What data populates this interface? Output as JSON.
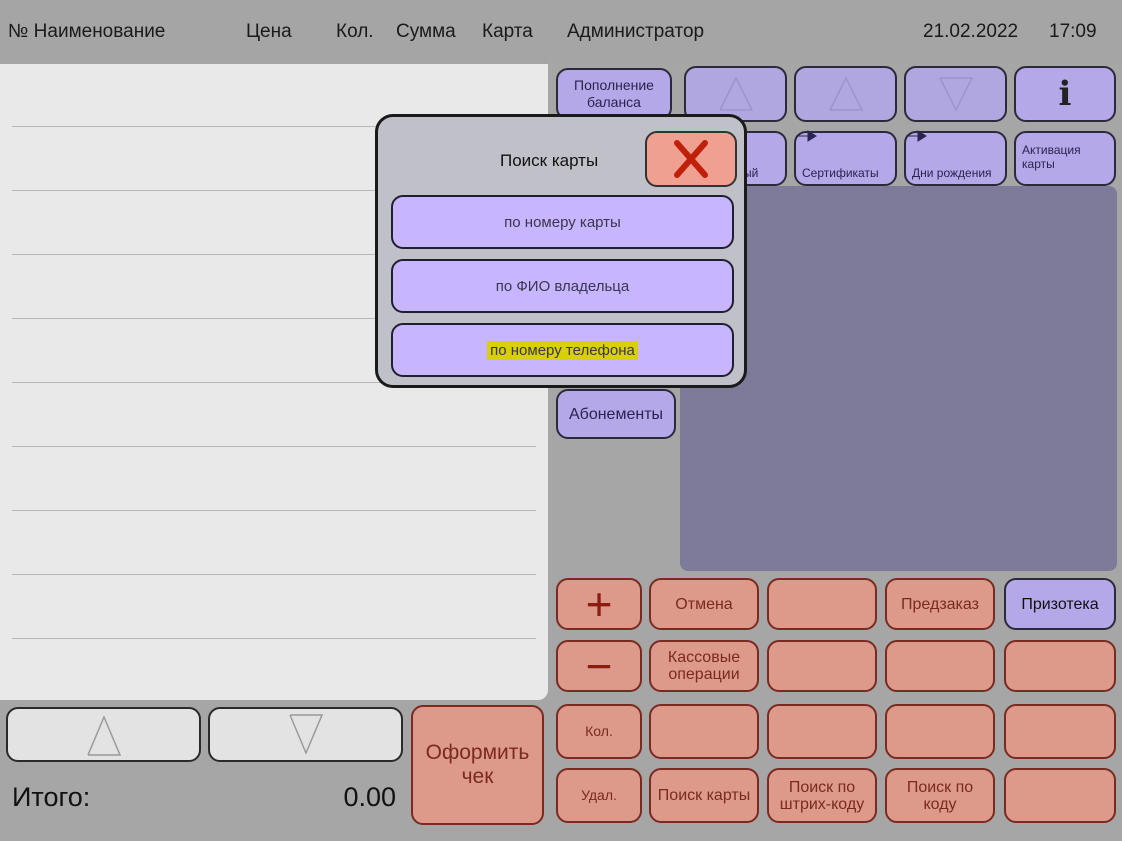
{
  "receipt": {
    "headers": {
      "num_name": "№ Наименование",
      "price": "Цена",
      "qty": "Кол.",
      "sum": "Сумма",
      "card": "Карта"
    },
    "total_label": "Итого:",
    "total_value": "0.00",
    "checkout_label": "Оформить чек"
  },
  "topbar": {
    "user": "Администратор",
    "date": "21.02.2022",
    "time": "17:09"
  },
  "function_buttons": {
    "topup": "Пополнение баланса",
    "info": "i",
    "fragment": "ый",
    "certificates": "Сертификаты",
    "birthdays": "Дни рождения",
    "card_activation": "Активация карты",
    "subscriptions": "Абонементы"
  },
  "keypad": {
    "plus": "+",
    "minus": "−",
    "cancel": "Отмена",
    "preorder": "Предзаказ",
    "prize": "Призотека",
    "cash_ops": "Кассовые операции",
    "qty": "Кол.",
    "delete": "Удал.",
    "card_search": "Поиск карты",
    "barcode_search": "Поиск по штрих-коду",
    "code_search": "Поиск по коду"
  },
  "modal": {
    "title": "Поиск карты",
    "by_card_number": "по номеру карты",
    "by_owner_name": "по ФИО владельца",
    "by_phone": "по номеру телефона"
  },
  "colors": {
    "accent_red": "#dd9a8a",
    "accent_purple": "#b5a8e8",
    "highlight": "#d8d000"
  }
}
